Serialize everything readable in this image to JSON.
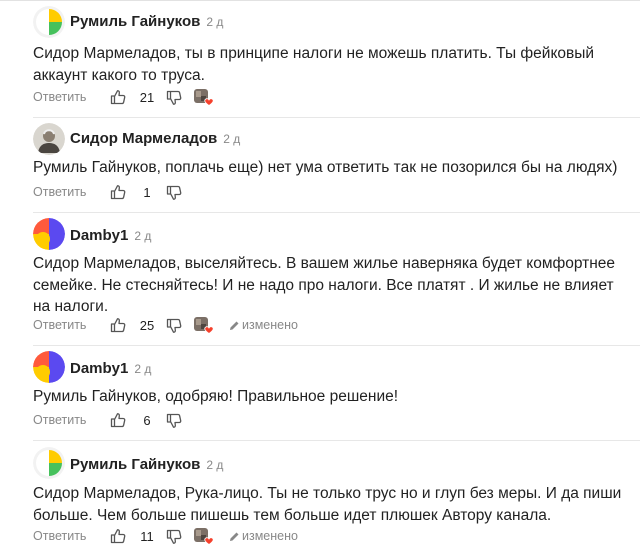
{
  "comments": [
    {
      "author": "Румиль Гайнуков",
      "time": "2 д",
      "avatar": "yandex-logo",
      "text": "Сидор Мармеладов, ты в принципе налоги не можешь платить. Ты фейковый аккаунт какого то труса.",
      "reply_label": "Ответить",
      "likes": "21",
      "reactor_icon": "reactor-avatar-heart",
      "edited": ""
    },
    {
      "author": "Сидор Мармеладов",
      "time": "2 д",
      "avatar": "photo",
      "text": "Румиль Гайнуков, поплачь еще) нет ума ответить так не позорился бы на людях)",
      "reply_label": "Ответить",
      "likes": "1",
      "reactor_icon": "",
      "edited": ""
    },
    {
      "author": "Damby1",
      "time": "2 д",
      "avatar": "colorful-circle",
      "text": "Сидор Мармеладов, выселяйтесь. В вашем жилье наверняка будет комфортнее семейке. Не стесняйтесь! И не надо про налоги. Все платят . И жилье не влияет на налоги.",
      "reply_label": "Ответить",
      "likes": "25",
      "reactor_icon": "reactor-avatar-heart",
      "edited": "изменено"
    },
    {
      "author": "Damby1",
      "time": "2 д",
      "avatar": "colorful-circle",
      "text": "Румиль Гайнуков, одобряю! Правильное решение!",
      "reply_label": "Ответить",
      "likes": "6",
      "reactor_icon": "",
      "edited": ""
    },
    {
      "author": "Румиль Гайнуков",
      "time": "2 д",
      "avatar": "yandex-logo",
      "text": "Сидор Мармеладов, Рука-лицо. Ты не только трус но и глуп без меры. И да пиши больше. Чем больше пишешь тем больше идет плюшек Автору канала.",
      "reply_label": "Ответить",
      "likes": "11",
      "reactor_icon": "reactor-avatar-heart",
      "edited": "изменено"
    }
  ],
  "colors": {
    "yellow": "#FFCC00",
    "green": "#46C15C",
    "blue": "#5B49F0",
    "orange": "#FF5A3C",
    "heart": "#F5402C"
  }
}
